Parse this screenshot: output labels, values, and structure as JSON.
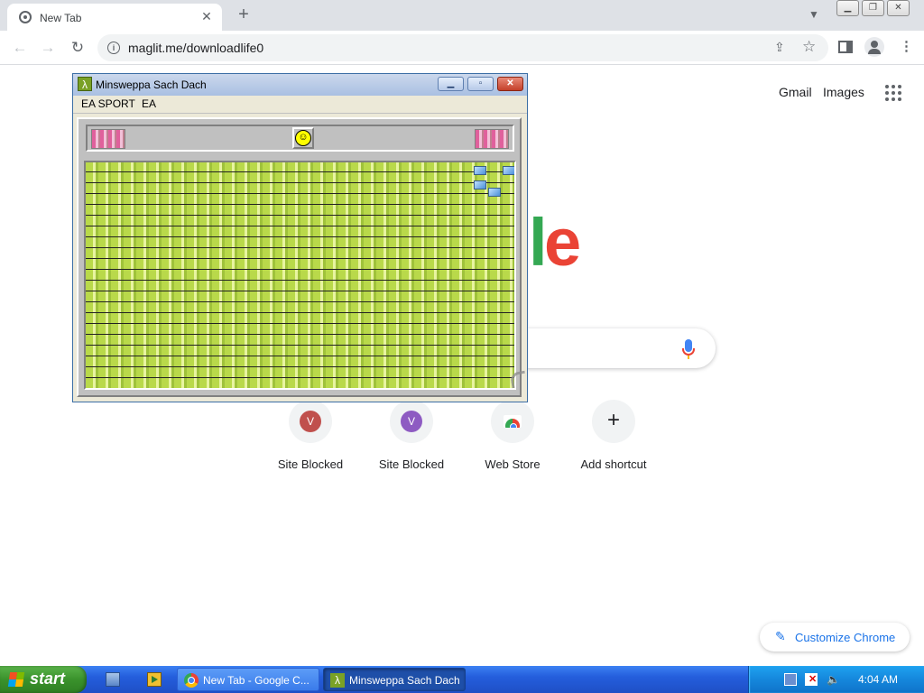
{
  "browser": {
    "tab": {
      "title": "New Tab"
    },
    "address_bar": {
      "url": "maglit.me/downloadlife0"
    }
  },
  "ntp": {
    "header_links": [
      "Gmail",
      "Images"
    ],
    "logo_visible_text": "le",
    "shortcuts": [
      {
        "label": "Site Blocked",
        "letter": "V",
        "color": "#c0504d"
      },
      {
        "label": "Site Blocked",
        "letter": "V",
        "color": "#8e5bc2"
      },
      {
        "label": "Web Store"
      },
      {
        "label": "Add shortcut",
        "symbol": "+"
      }
    ],
    "customize_label": "Customize Chrome"
  },
  "minesweeper": {
    "title": "Minsweppa Sach Dach",
    "app_icon_glyph": "λ",
    "menu": [
      "EA SPORT",
      "EA"
    ],
    "smiley_glyph": "☺"
  },
  "taskbar": {
    "start_label": "start",
    "tasks": [
      {
        "label": "New Tab - Google C...",
        "icon": "chrome-icon"
      },
      {
        "label": "Minsweppa Sach Dach",
        "icon": "minesweeper-app-icon"
      }
    ],
    "clock": "4:04 AM"
  },
  "colors": {
    "google_green": "#34a853",
    "google_red": "#ea4335",
    "chrome_blue": "#1a73e8",
    "xp_taskbar": "#245edc",
    "xp_start": "#3a922c"
  }
}
